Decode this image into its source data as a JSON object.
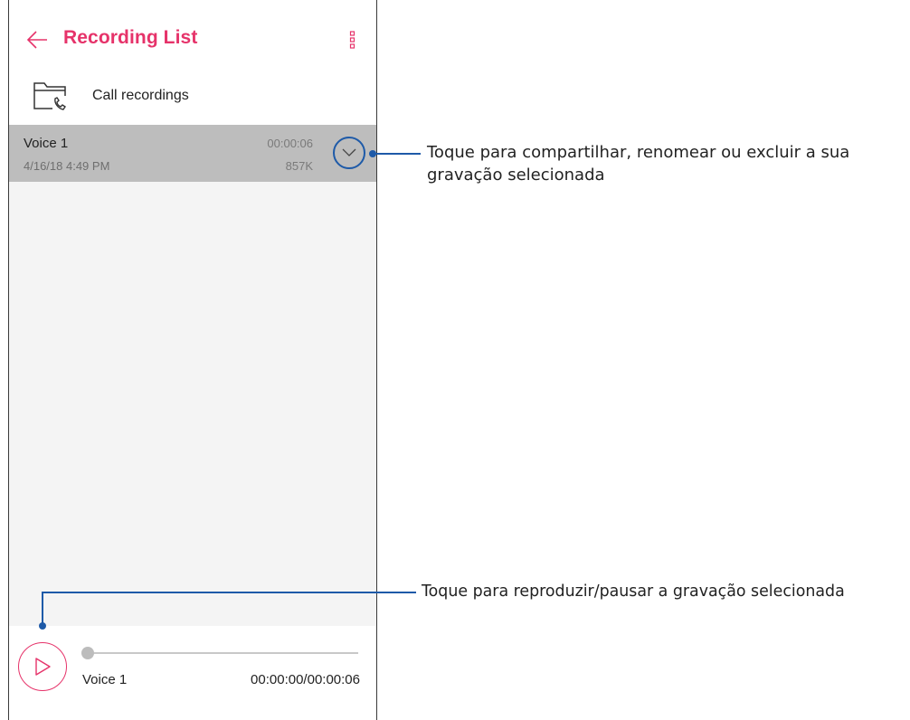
{
  "header": {
    "title": "Recording List",
    "back_icon": "back-arrow-icon",
    "menu_icon": "more-vertical-icon"
  },
  "folder": {
    "label": "Call recordings",
    "icon": "folder-phone-icon"
  },
  "recordings": [
    {
      "name": "Voice 1",
      "date": "4/16/18 4:49 PM",
      "duration": "00:00:06",
      "size": "857K",
      "selected": true
    }
  ],
  "player": {
    "track_name": "Voice 1",
    "time": "00:00:00/00:00:06",
    "progress": 0
  },
  "callouts": {
    "expand": "Toque para compartilhar, renomear ou excluir a sua gravação selecionada",
    "play": "Toque para reproduzir/pausar a gravação selecionada"
  },
  "colors": {
    "accent": "#e6336a",
    "callout": "#1e5aa8",
    "selected_row": "#bdbdbd"
  }
}
